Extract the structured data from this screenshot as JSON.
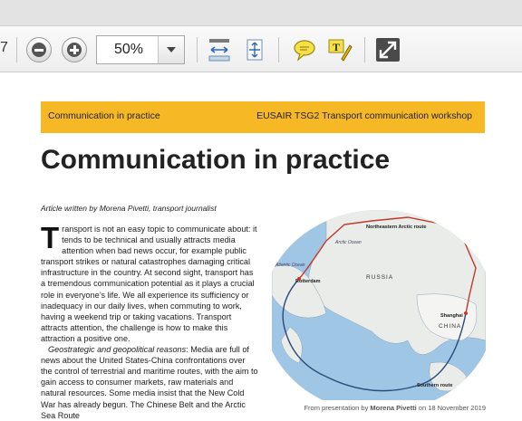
{
  "viewer": {
    "page_number": "7",
    "zoom": "50%",
    "icons": [
      "zoom-out-icon",
      "zoom-in-icon",
      "fit-width-icon",
      "fit-page-icon",
      "comment-icon",
      "highlight-text-icon",
      "fullscreen-icon"
    ],
    "colors": {
      "toolbar": "#eeeeee",
      "accent_header": "#f7b825"
    }
  },
  "document": {
    "header_left": "Communication in practice",
    "header_right": "EUSAIR TSG2 Transport communication workshop",
    "title": "Communication in practice",
    "byline": "Article written by Morena Pivetti, transport journalist",
    "dropcap": "T",
    "para1": "ransport is not an easy topic to communicate about: it tends to be technical and usually attracts media attention when bad news occur, for example public transport strikes or natural catastrophes damaging critical infrastructure in the country. At second sight, transport has a tremendous communication potential as it plays a crucial role in everyone’s life. We all experience its sufficiency or inadequacy in our daily lives, when commuting to work, having a weekend trip or taking vacations. Transport attracts attention, the challenge is how to make this attraction a positive one.",
    "para2_lead": "Geostrategic and geopolitical reasons",
    "para2": ": Media are full of news about the United States-China confrontations over the control of terrestrial and maritime routes, with the aim to gain access to consumer markets, raw materials and natural resources. Some media insist that the New Cold War has already begun. The Chinese Belt and the Arctic Sea Route",
    "map": {
      "labels": [
        "Northeastern Arctic route",
        "Arctic Ocean",
        "Atlantic Ocean",
        "Rotterdam",
        "RUSSIA",
        "Shanghai",
        "CHINA",
        "Southern route"
      ]
    },
    "caption_prefix": "From presentation by ",
    "caption_author": "Morena Pivetti",
    "caption_suffix": " on 18 November 2019"
  }
}
